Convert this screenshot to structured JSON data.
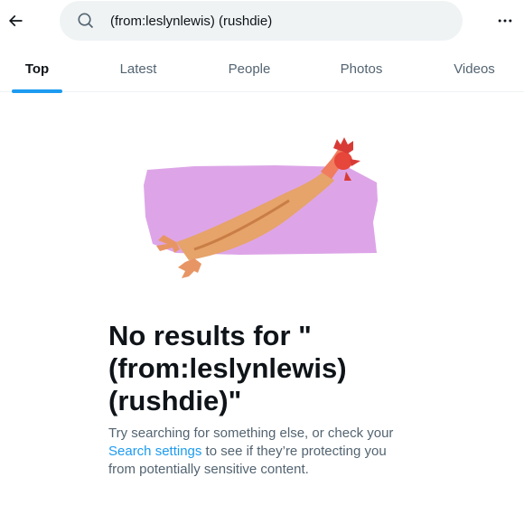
{
  "search": {
    "query": "(from:leslynlewis) (rushdie)"
  },
  "icons": {
    "back": "arrow-left-icon",
    "search": "search-icon",
    "more": "more-horizontal-icon"
  },
  "tabs": [
    {
      "label": "Top",
      "active": true
    },
    {
      "label": "Latest",
      "active": false
    },
    {
      "label": "People",
      "active": false
    },
    {
      "label": "Photos",
      "active": false
    },
    {
      "label": "Videos",
      "active": false
    }
  ],
  "empty_state": {
    "title": "No results for \"(from:leslynlewis) (rushdie)\"",
    "message_before": "Try searching for something else, or check your ",
    "settings_link": "Search settings",
    "message_after": " to see if they’re protecting you from potentially sensitive content.",
    "illustration": "rubber-chicken"
  },
  "colors": {
    "accent": "#1d9bf0",
    "search_bg": "#eff3f4",
    "secondary_text": "#536471",
    "illustration_bg": "#dda5e8"
  }
}
